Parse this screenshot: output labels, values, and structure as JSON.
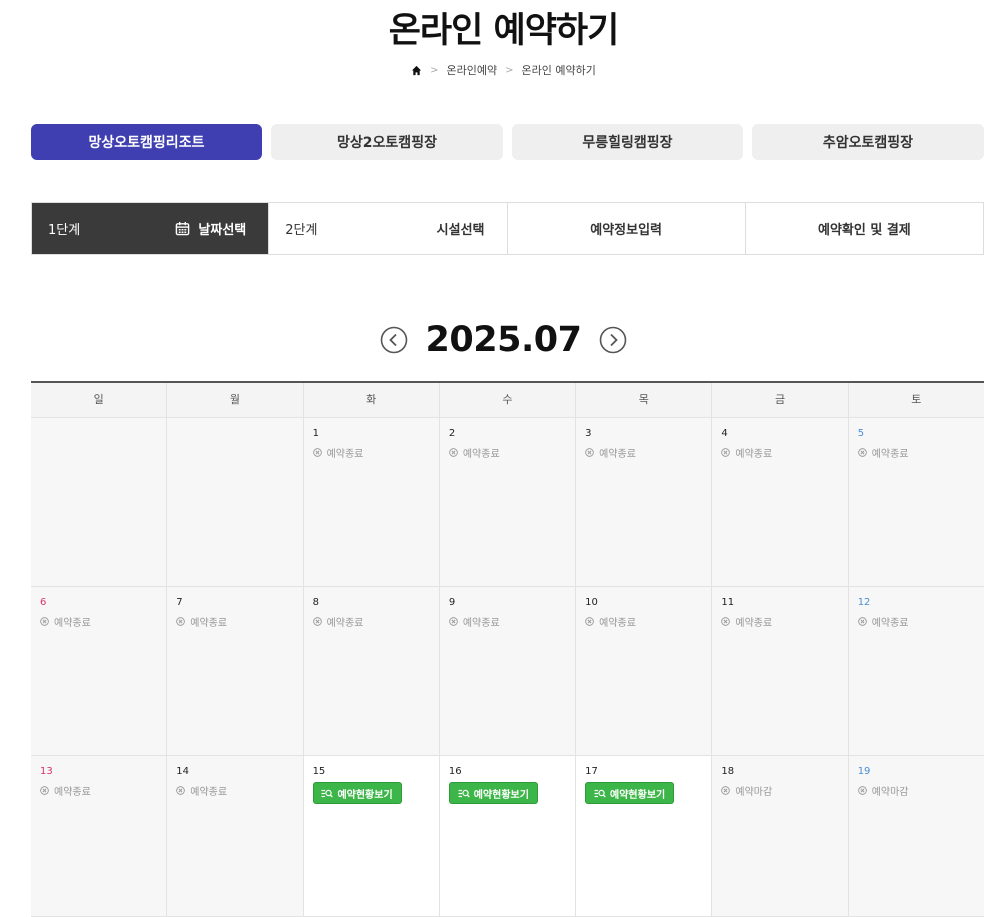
{
  "page": {
    "title": "온라인 예약하기"
  },
  "breadcrumb": {
    "home_icon": "home-icon",
    "items": [
      "온라인예약",
      "온라인 예약하기"
    ]
  },
  "sites": {
    "active_color": "#3f3fb1",
    "items": [
      {
        "label": "망상오토캠핑리조트",
        "active": true
      },
      {
        "label": "망상2오토캠핑장",
        "active": false
      },
      {
        "label": "무릉힐링캠핑장",
        "active": false
      },
      {
        "label": "추암오토캠핑장",
        "active": false
      }
    ]
  },
  "steps": {
    "items": [
      {
        "num": "1단계",
        "label": "날짜선택",
        "icon": "calendar-icon",
        "active": true
      },
      {
        "num": "2단계",
        "label": "시설선택",
        "active": false
      },
      {
        "label": "예약정보입력",
        "active": false
      },
      {
        "label": "예약확인 및 결제",
        "active": false
      }
    ]
  },
  "calendar": {
    "month": "2025.07",
    "prev_icon": "chevron-left-icon",
    "next_icon": "chevron-right-icon",
    "weekdays": [
      "일",
      "월",
      "화",
      "수",
      "목",
      "금",
      "토"
    ],
    "button_color": "#3cb648",
    "weeks": [
      [
        null,
        null,
        {
          "day": "1",
          "status": "예약종료"
        },
        {
          "day": "2",
          "status": "예약종료"
        },
        {
          "day": "3",
          "status": "예약종료"
        },
        {
          "day": "4",
          "status": "예약종료"
        },
        {
          "day": "5",
          "status": "예약종료"
        }
      ],
      [
        {
          "day": "6",
          "status": "예약종료"
        },
        {
          "day": "7",
          "status": "예약종료"
        },
        {
          "day": "8",
          "status": "예약종료"
        },
        {
          "day": "9",
          "status": "예약종료"
        },
        {
          "day": "10",
          "status": "예약종료"
        },
        {
          "day": "11",
          "status": "예약종료"
        },
        {
          "day": "12",
          "status": "예약종료"
        }
      ],
      [
        {
          "day": "13",
          "status": "예약종료"
        },
        {
          "day": "14",
          "status": "예약종료"
        },
        {
          "day": "15",
          "button": "예약현황보기"
        },
        {
          "day": "16",
          "button": "예약현황보기"
        },
        {
          "day": "17",
          "button": "예약현황보기"
        },
        {
          "day": "18",
          "status": "예약마감"
        },
        {
          "day": "19",
          "status": "예약마감"
        }
      ]
    ]
  }
}
